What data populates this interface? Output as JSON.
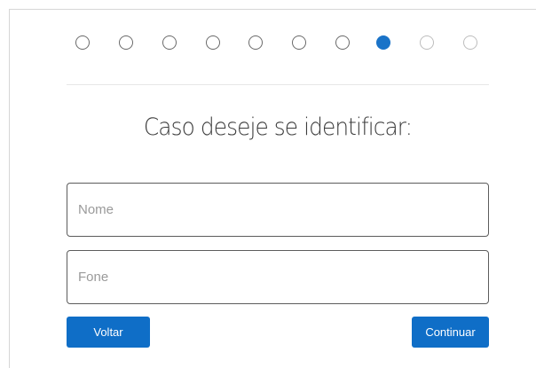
{
  "stepper": {
    "total_steps": 10,
    "current_step": 8,
    "colors": {
      "completed": "#6a6a6a",
      "active": "#1a73c8",
      "upcoming": "#bdbdbd"
    }
  },
  "form": {
    "title": "Caso deseje se identificar:",
    "name_field": {
      "placeholder": "Nome",
      "value": ""
    },
    "phone_field": {
      "placeholder": "Fone",
      "value": ""
    }
  },
  "buttons": {
    "back_label": "Voltar",
    "continue_label": "Continuar",
    "color": "#0f6ec7"
  }
}
